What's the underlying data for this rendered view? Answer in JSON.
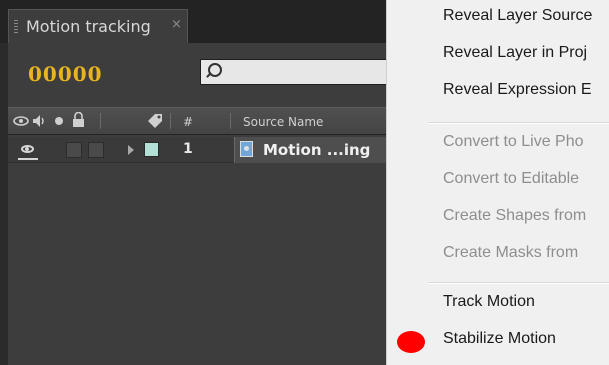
{
  "panel": {
    "tab_title": "Motion tracking",
    "close_glyph": "×",
    "timecode": "00000",
    "search": {
      "placeholder": "",
      "icon": "search-icon"
    },
    "columns": {
      "number": "#",
      "source_name": "Source Name"
    },
    "layer": {
      "number": "1",
      "name": "Motion ...ing",
      "label_color": "#b4e1d7"
    }
  },
  "menu": {
    "items": [
      {
        "label": "Reveal Layer Source",
        "enabled": true
      },
      {
        "label": "Reveal Layer in Proj",
        "enabled": true
      },
      {
        "label": "Reveal Expression E",
        "enabled": true
      },
      {
        "label": "Convert to Live Pho",
        "enabled": false
      },
      {
        "label": "Convert to Editable",
        "enabled": false
      },
      {
        "label": "Create Shapes from",
        "enabled": false
      },
      {
        "label": "Create Masks from",
        "enabled": false
      },
      {
        "label": "Track Motion",
        "enabled": true
      },
      {
        "label": "Stabilize Motion",
        "enabled": true
      }
    ],
    "highlight_marker_color": "#ff0000"
  }
}
